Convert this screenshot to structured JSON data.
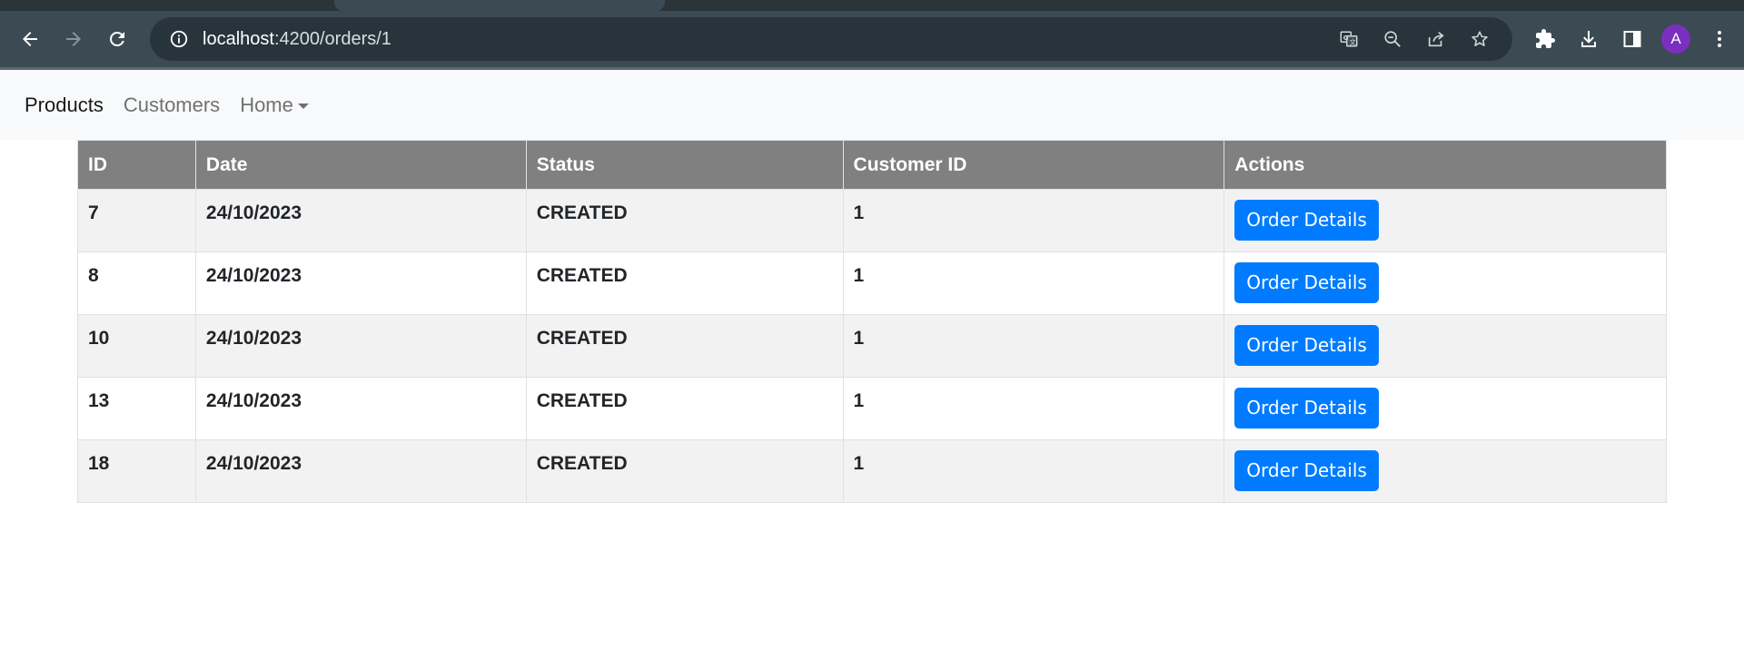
{
  "browser": {
    "url_host": "localhost",
    "url_rest": ":4200/orders/1",
    "avatar_initial": "A",
    "icons": {
      "back": "back-arrow-icon",
      "forward": "forward-arrow-icon",
      "reload": "reload-icon",
      "site_info": "info-icon",
      "translate": "translate-icon",
      "zoom": "zoom-out-icon",
      "share": "share-icon",
      "bookmark": "star-icon",
      "extensions": "puzzle-icon",
      "downloads": "download-icon",
      "side_panel": "side-panel-icon",
      "menu": "kebab-menu-icon"
    },
    "colors": {
      "toolbar_bg": "#3c4a53",
      "omnibox_bg": "#27343b",
      "avatar_bg": "#7b2fbe"
    }
  },
  "navbar": {
    "items": [
      {
        "label": "Products",
        "active": true
      },
      {
        "label": "Customers",
        "active": false
      }
    ],
    "dropdown_label": "Home"
  },
  "orders_table": {
    "columns": [
      "ID",
      "Date",
      "Status",
      "Customer ID",
      "Actions"
    ],
    "rows": [
      {
        "id": "7",
        "date": "24/10/2023",
        "status": "CREATED",
        "customer_id": "1",
        "action_label": "Order Details"
      },
      {
        "id": "8",
        "date": "24/10/2023",
        "status": "CREATED",
        "customer_id": "1",
        "action_label": "Order Details"
      },
      {
        "id": "10",
        "date": "24/10/2023",
        "status": "CREATED",
        "customer_id": "1",
        "action_label": "Order Details"
      },
      {
        "id": "13",
        "date": "24/10/2023",
        "status": "CREATED",
        "customer_id": "1",
        "action_label": "Order Details"
      },
      {
        "id": "18",
        "date": "24/10/2023",
        "status": "CREATED",
        "customer_id": "1",
        "action_label": "Order Details"
      }
    ],
    "colors": {
      "header_bg": "#808080",
      "stripe_bg": "#f2f2f2",
      "button_bg": "#007bff"
    }
  }
}
